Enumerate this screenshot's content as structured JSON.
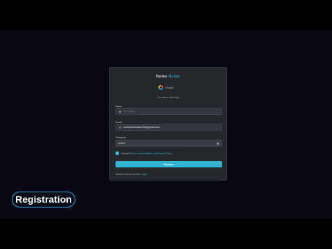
{
  "brand": {
    "part1": "Notes",
    "part2": "Nudge"
  },
  "google": {
    "label": "Google"
  },
  "divider": {
    "text": "Or continue with email"
  },
  "fields": {
    "name": {
      "label": "Name",
      "placeholder": "Full Name",
      "value": ""
    },
    "email": {
      "label": "Email",
      "value": "muhtashimhasan158@gmail.com"
    },
    "password": {
      "label": "Password",
      "value": "••••••••"
    }
  },
  "terms": {
    "prefix": "I accept",
    "link": "Terms and conditions and Privacy Policy",
    "checked": true
  },
  "register_button": {
    "label": "Register"
  },
  "login": {
    "prompt": "Already have an account?",
    "link": "Login"
  },
  "caption": {
    "label": "Registration"
  },
  "colors": {
    "accent": "#33b4d2",
    "card": "#24272c",
    "background": "#070810",
    "pill_border": "#2fa9e6"
  },
  "icons": {
    "name_field": "user-icon",
    "email_field": "mail-icon",
    "password_toggle": "eye-icon",
    "google": "google-icon"
  }
}
